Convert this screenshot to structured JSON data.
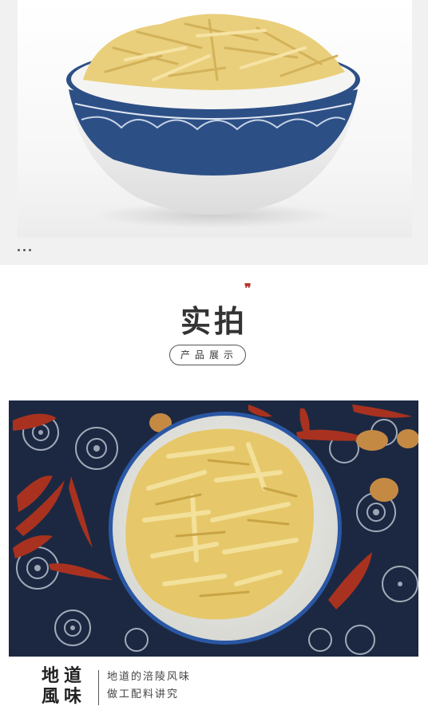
{
  "section": {
    "title": "实拍",
    "subtitle": "产品展示"
  },
  "caption": {
    "title_line1": "地道",
    "title_line2": "風味",
    "line1": "地道的涪陵风味",
    "line2": "做工配料讲究"
  },
  "colors": {
    "accent": "#b3332b",
    "bowl_rim": "#2c4f86",
    "cloth": "#1c2841",
    "pickle": "#e9cf7b"
  }
}
